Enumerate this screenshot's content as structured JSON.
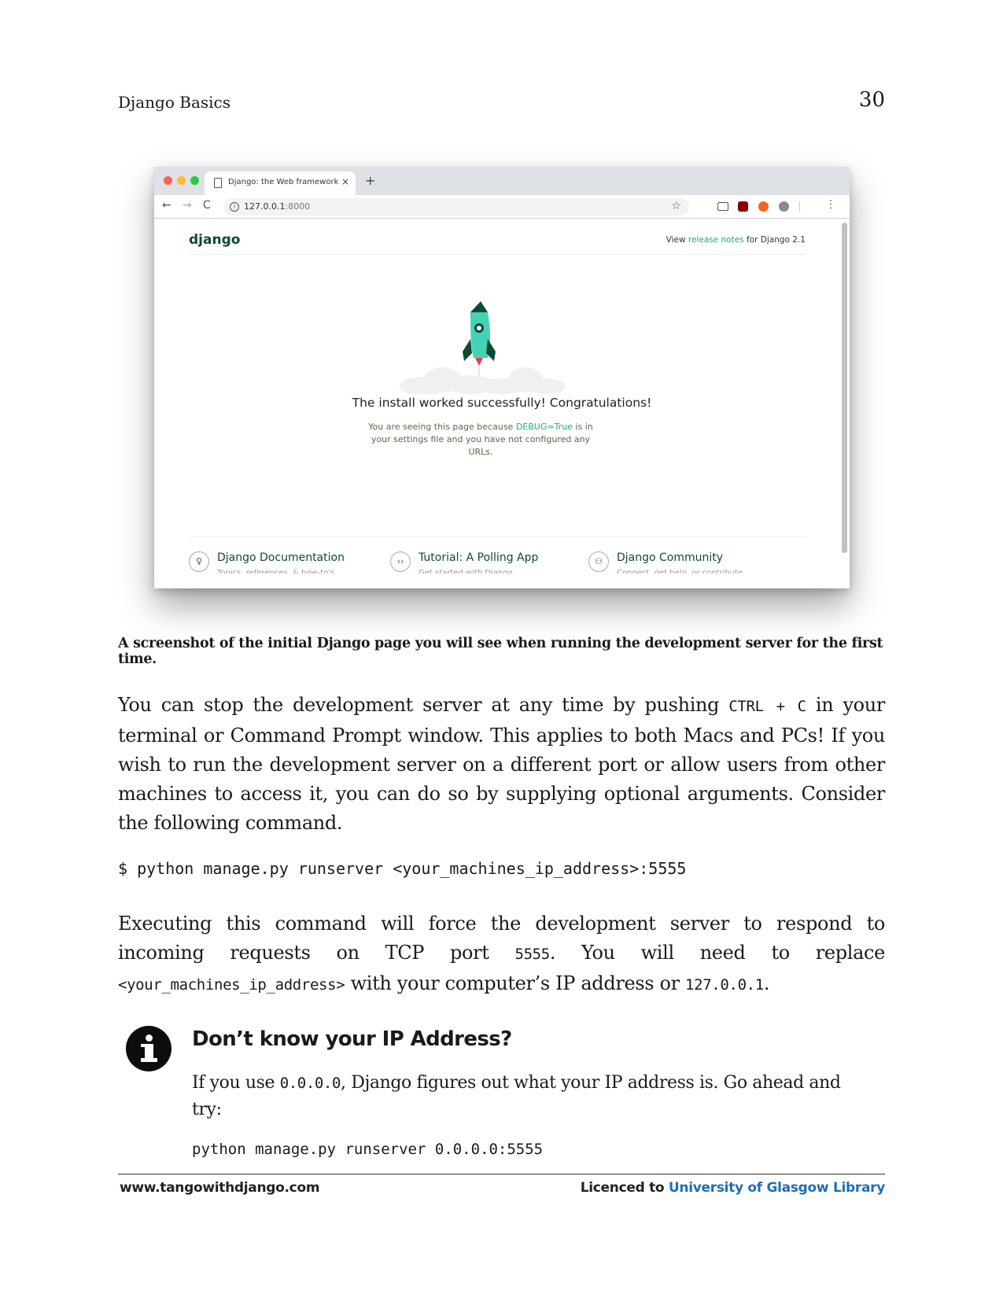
{
  "header": {
    "running_title": "Django Basics",
    "page_number": "30"
  },
  "figure": {
    "browser": {
      "tab_title": "Django: the Web framework fo",
      "tab_close": "×",
      "new_tab": "+",
      "back": "←",
      "forward": "→",
      "reload": "C",
      "url_host": "127.0.0.1",
      "url_port": ":8000",
      "star": "☆",
      "menu": "⋮"
    },
    "page": {
      "logo": "django",
      "release_prefix": "View ",
      "release_link": "release notes",
      "release_suffix": " for Django 2.1",
      "success_title": "The install worked successfully! Congratulations!",
      "success_sub_1": "You are seeing this page because ",
      "success_sub_debug": "DEBUG=True",
      "success_sub_2": " is in your settings file and you have not configured any URLs.",
      "footer_items": [
        {
          "icon": "lightbulb-icon",
          "glyph": "♀",
          "title": "Django Documentation",
          "subtitle": "Topics, references, & how-to's"
        },
        {
          "icon": "code-icon",
          "glyph": "‹›",
          "title": "Tutorial: A Polling App",
          "subtitle": "Get started with Django"
        },
        {
          "icon": "community-icon",
          "glyph": "⚇",
          "title": "Django Community",
          "subtitle": "Connect, get help, or contribute"
        }
      ]
    }
  },
  "caption": "A screenshot of the initial Django page you will see when running the development server for the first time.",
  "paragraph1": {
    "part1": "You can stop the development server at any time by pushing ",
    "code1": "CTRL + C",
    "part2": " in your terminal or Command Prompt window. This applies to both Macs and PCs! If you wish to run the development server on a different port or allow users from other machines to access it, you can do so by supplying optional arguments. Consider the following command."
  },
  "command": "$ python manage.py runserver <your_machines_ip_address>:5555",
  "paragraph2": {
    "part1": "Executing this command will force the development server to respond to incoming requests on TCP port ",
    "code1": "5555",
    "part2": ". You will need to replace ",
    "code2": "<your_machines_ip_address>",
    "part3": " with your computer’s IP address or ",
    "code3": "127.0.0.1",
    "part4": "."
  },
  "tip": {
    "title": "Don’t know your IP Address?",
    "body_part1": "If you use ",
    "body_code": "0.0.0.0",
    "body_part2": ", Django figures out what your IP address is. Go ahead and try:",
    "command": "python manage.py runserver 0.0.0.0:5555"
  },
  "footer": {
    "website": "www.tangowithdjango.com",
    "licence_prefix": "Licenced to ",
    "licence_holder": "University of Glasgow Library"
  }
}
